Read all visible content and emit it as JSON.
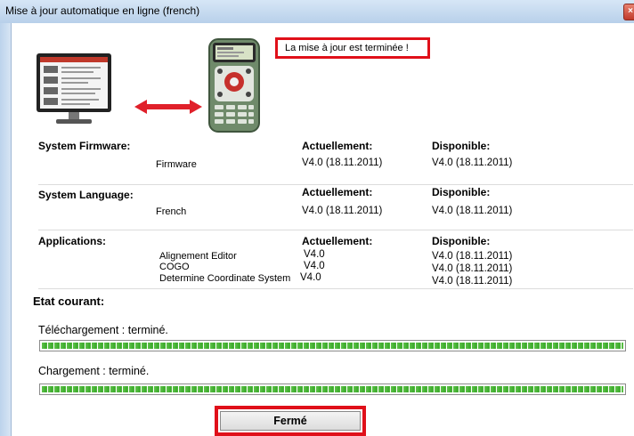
{
  "window": {
    "title": "Mise à jour automatique en ligne (french)"
  },
  "message": "La mise à jour est terminée !",
  "headers": {
    "current": "Actuellement:",
    "available": "Disponible:"
  },
  "sections": [
    {
      "label": "System Firmware:",
      "items": [
        {
          "name": "Firmware",
          "current": "V4.0 (18.11.2011)",
          "available": "V4.0 (18.11.2011)"
        }
      ]
    },
    {
      "label": "System Language:",
      "items": [
        {
          "name": "French",
          "current": "V4.0 (18.11.2011)",
          "available": "V4.0 (18.11.2011)"
        }
      ]
    },
    {
      "label": "Applications:",
      "items": [
        {
          "name": "Alignement Editor",
          "current": "V4.0",
          "available": "V4.0 (18.11.2011)"
        },
        {
          "name": "COGO",
          "current": "V4.0",
          "available": "V4.0 (18.11.2011)"
        },
        {
          "name": "Determine Coordinate System",
          "current": "V4.0",
          "available": "V4.0 (18.11.2011)"
        }
      ]
    }
  ],
  "status": {
    "title": "Etat courant:",
    "download_label": "Téléchargement : terminé.",
    "download_progress": 1.0,
    "upload_label": "Chargement : terminé.",
    "upload_progress": 1.0
  },
  "close_button": "Fermé",
  "colors": {
    "highlight": "#e0101a",
    "progress": "#4cb83a",
    "arrow": "#e0202a"
  }
}
